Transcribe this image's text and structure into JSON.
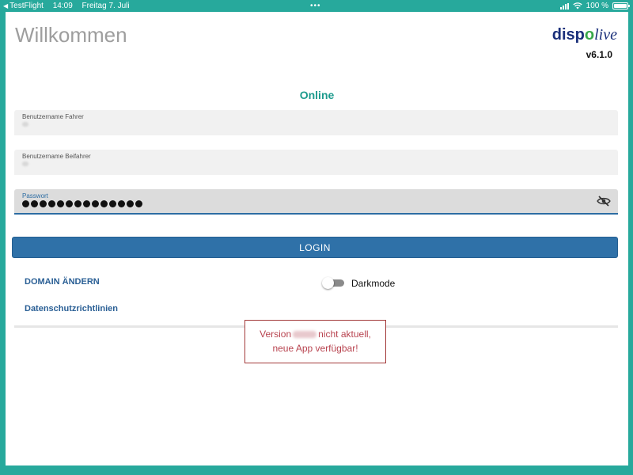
{
  "status_bar": {
    "back_app": "TestFlight",
    "time": "14:09",
    "date": "Freitag 7. Juli",
    "battery": "100 %"
  },
  "header": {
    "title": "Willkommen",
    "logo": {
      "part1": "disp",
      "part2": "o",
      "part3": "live"
    },
    "version": "v6.1.0"
  },
  "connection_status": "Online",
  "form": {
    "driver_label": "Benutzername Fahrer",
    "codriver_label": "Benutzername Beifahrer",
    "password_label": "Passwort",
    "password_length": 14,
    "login_label": "LOGIN"
  },
  "links": {
    "change_domain": "DOMAIN ÄNDERN",
    "privacy": "Datenschutzrichtlinien"
  },
  "darkmode": {
    "label": "Darkmode",
    "enabled": false
  },
  "update_notice": {
    "prefix": "Version",
    "suffix": "nicht aktuell,",
    "line2": "neue App verfügbar!"
  },
  "colors": {
    "frame": "#27a99c",
    "accent": "#2f71a8",
    "online": "#1d9b8d",
    "warning": "#b8434f"
  }
}
